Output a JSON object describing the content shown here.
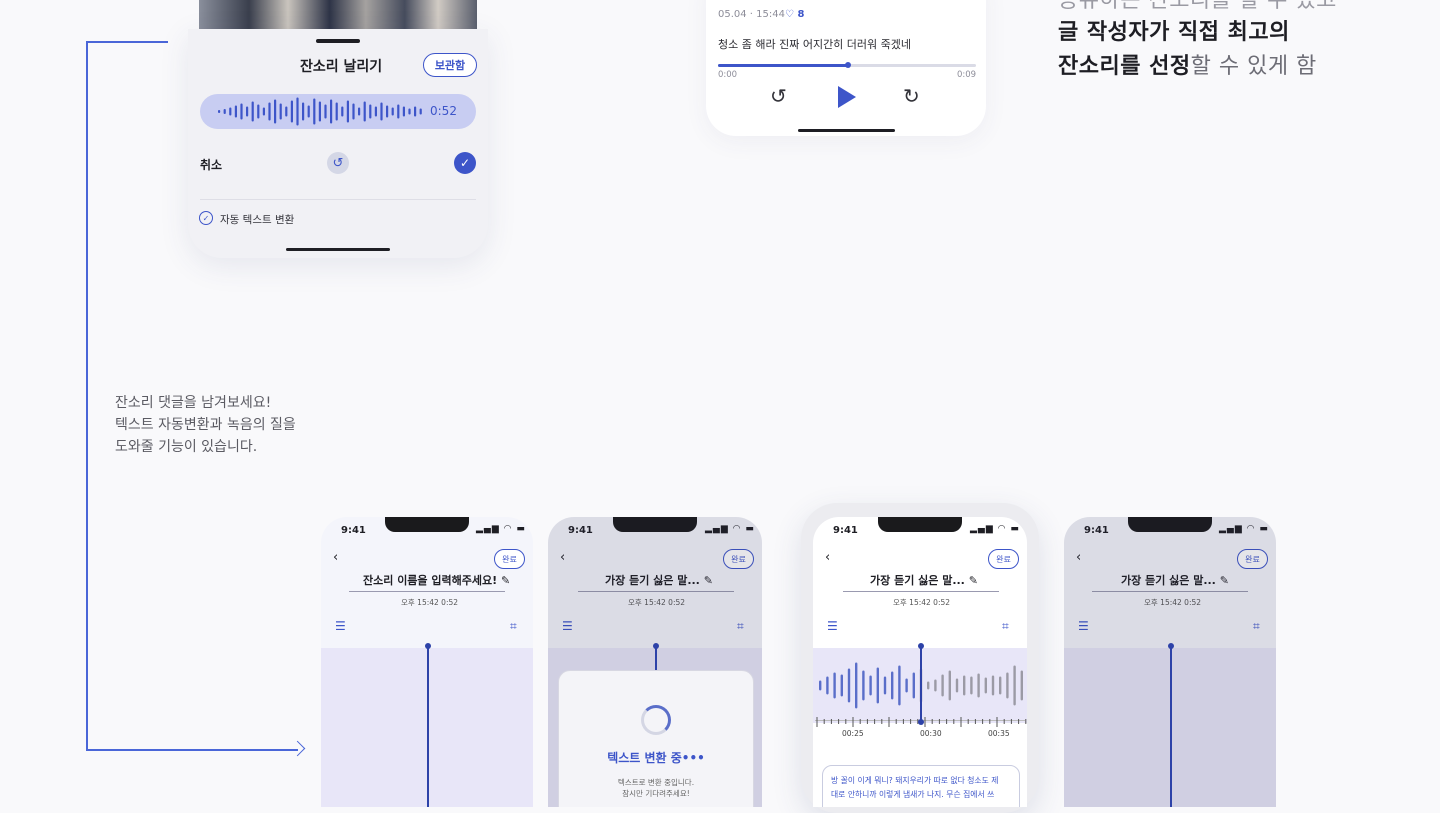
{
  "sheet": {
    "title": "잔소리 날리기",
    "store_button": "보관함",
    "duration": "0:52",
    "cancel_label": "취소",
    "undo_icon": "undo-icon",
    "confirm_icon": "check-icon",
    "auto_text_label": "자동 텍스트 변환"
  },
  "card": {
    "meta": "05.04 · 15:44",
    "likes": "8",
    "comment": "청소 좀 해라 진짜 어지간히 더러워 죽겠네",
    "time_start": "0:00",
    "time_end": "0:09",
    "progress": 0.5
  },
  "copy_right": {
    "line0": "공유하는 잔소리를 할 수 있고",
    "line1": "글 작성자가 직접 최고의",
    "line2_bold": "잔소리를 선정",
    "line2_light": "할 수 있게 함"
  },
  "description": {
    "line1": "잔소리 댓글을 남겨보세요!",
    "line2": "텍스트 자동변환과 녹음의 질을",
    "line3": "도와줄 기능이 있습니다."
  },
  "phones": [
    {
      "time": "9:41",
      "done": "완료",
      "title": "잔소리 이름을 입력해주세요!",
      "date": "오후 15:42  0:52"
    },
    {
      "time": "9:41",
      "done": "완료",
      "title": "가장 듣기 싫은 말...",
      "date": "오후 15:42  0:52",
      "converting_title": "텍스트 변환 중•••",
      "converting_sub1": "텍스트로 변환 중입니다.",
      "converting_sub2": "잠시만 기다려주세요!"
    },
    {
      "time": "9:41",
      "done": "완료",
      "title": "가장 듣기 싫은 말...",
      "date": "오후 15:42  0:52",
      "ticks": [
        "00:25",
        "00:30",
        "00:35"
      ],
      "transcript1": "방 꼴이 이게 뭐니? 돼지우리가 따로 없다 청소도 제",
      "transcript2": "대로 안하니까 이렇게 냄새가 나지. 무슨 집에서 쓰"
    },
    {
      "time": "9:41",
      "done": "완료",
      "title": "가장 듣기 싫은 말...",
      "date": "오후 15:42  0:52"
    }
  ],
  "colors": {
    "accent": "#3d55c9",
    "background": "#f9f9fb"
  }
}
